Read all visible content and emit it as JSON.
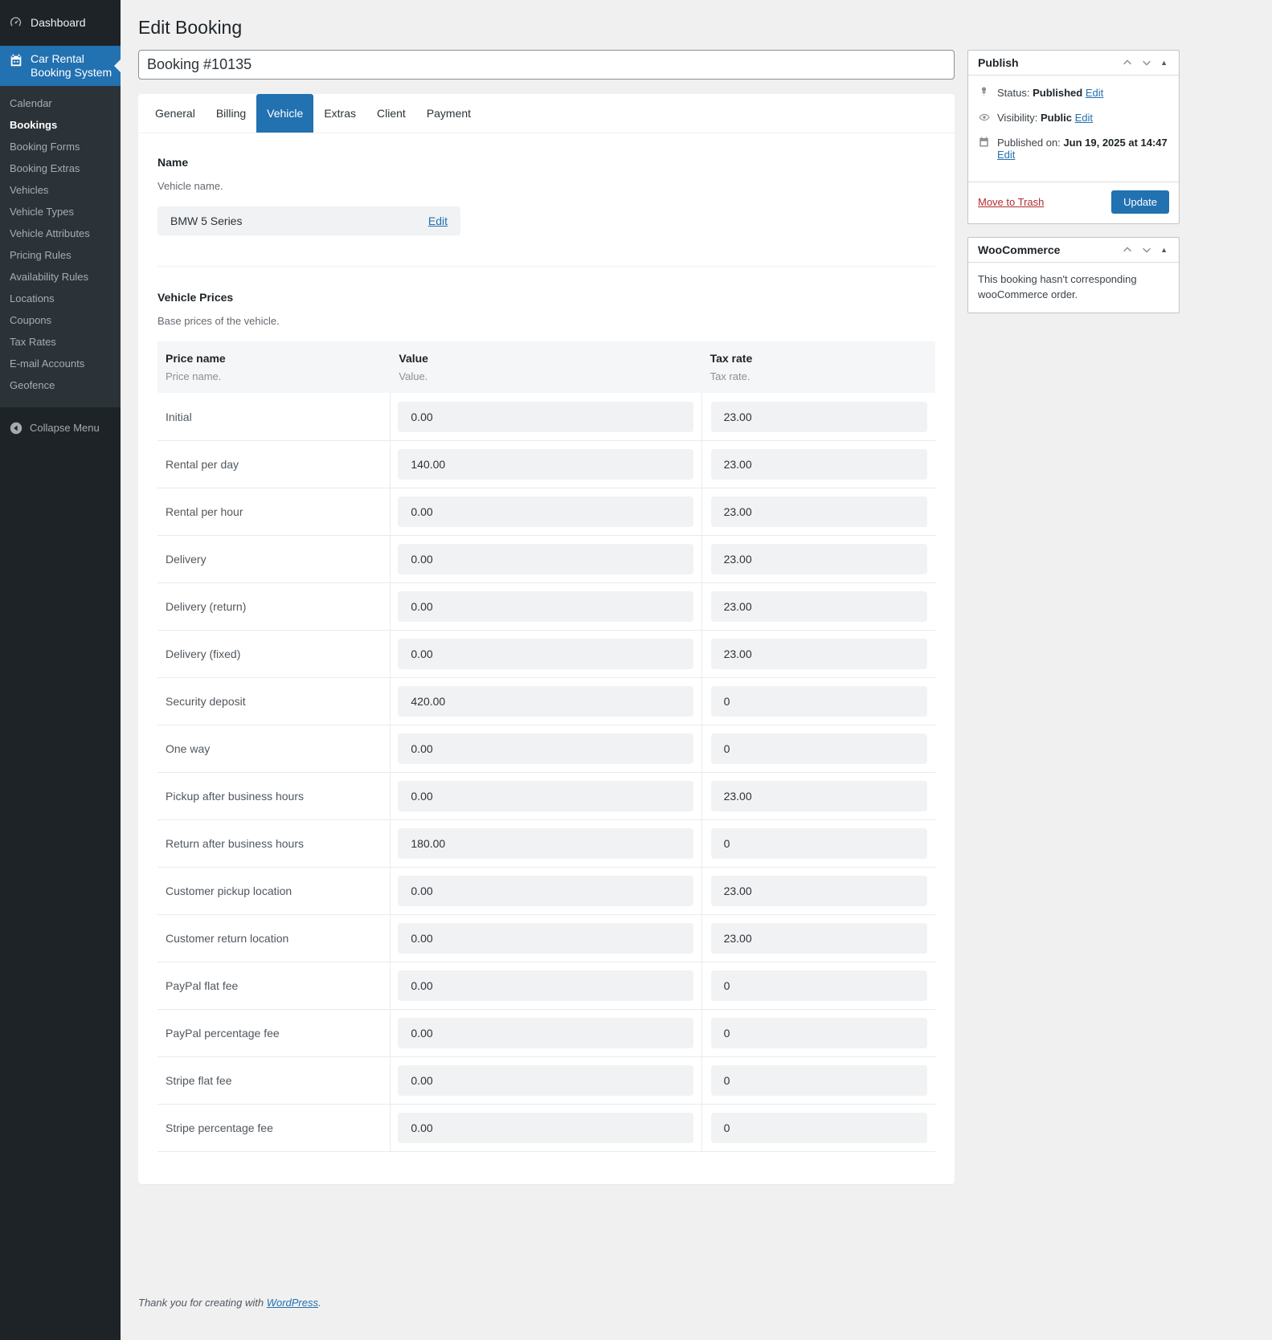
{
  "sidebar": {
    "dashboard_label": "Dashboard",
    "plugin_line1": "Car Rental",
    "plugin_line2": "Booking System",
    "items": [
      "Calendar",
      "Bookings",
      "Booking Forms",
      "Booking Extras",
      "Vehicles",
      "Vehicle Types",
      "Vehicle Attributes",
      "Pricing Rules",
      "Availability Rules",
      "Locations",
      "Coupons",
      "Tax Rates",
      "E-mail Accounts",
      "Geofence"
    ],
    "active_item": "Bookings",
    "collapse_label": "Collapse Menu"
  },
  "header": {
    "page_title": "Edit Booking",
    "booking_title": "Booking #10135"
  },
  "tabs": {
    "items": [
      "General",
      "Billing",
      "Vehicle",
      "Extras",
      "Client",
      "Payment"
    ],
    "active": "Vehicle"
  },
  "vehicle_tab": {
    "name_section": {
      "heading": "Name",
      "description": "Vehicle name.",
      "vehicle_name": "BMW 5 Series",
      "edit_label": "Edit"
    },
    "prices": {
      "heading": "Vehicle Prices",
      "description": "Base prices of the vehicle.",
      "columns": [
        {
          "label": "Price name",
          "sublabel": "Price name."
        },
        {
          "label": "Value",
          "sublabel": "Value."
        },
        {
          "label": "Tax rate",
          "sublabel": "Tax rate."
        }
      ],
      "rows": [
        {
          "name": "Initial",
          "value": "0.00",
          "tax": "23.00"
        },
        {
          "name": "Rental per day",
          "value": "140.00",
          "tax": "23.00"
        },
        {
          "name": "Rental per hour",
          "value": "0.00",
          "tax": "23.00"
        },
        {
          "name": "Delivery",
          "value": "0.00",
          "tax": "23.00"
        },
        {
          "name": "Delivery (return)",
          "value": "0.00",
          "tax": "23.00"
        },
        {
          "name": "Delivery (fixed)",
          "value": "0.00",
          "tax": "23.00"
        },
        {
          "name": "Security deposit",
          "value": "420.00",
          "tax": "0"
        },
        {
          "name": "One way",
          "value": "0.00",
          "tax": "0"
        },
        {
          "name": "Pickup after business hours",
          "value": "0.00",
          "tax": "23.00"
        },
        {
          "name": "Return after business hours",
          "value": "180.00",
          "tax": "0"
        },
        {
          "name": "Customer pickup location",
          "value": "0.00",
          "tax": "23.00"
        },
        {
          "name": "Customer return location",
          "value": "0.00",
          "tax": "23.00"
        },
        {
          "name": "PayPal flat fee",
          "value": "0.00",
          "tax": "0"
        },
        {
          "name": "PayPal percentage fee",
          "value": "0.00",
          "tax": "0"
        },
        {
          "name": "Stripe flat fee",
          "value": "0.00",
          "tax": "0"
        },
        {
          "name": "Stripe percentage fee",
          "value": "0.00",
          "tax": "0"
        }
      ]
    }
  },
  "publish_panel": {
    "title": "Publish",
    "status": {
      "label": "Status:",
      "value": "Published",
      "edit": "Edit"
    },
    "visibility": {
      "label": "Visibility:",
      "value": "Public",
      "edit": "Edit"
    },
    "published_on": {
      "label": "Published on:",
      "value": "Jun 19, 2025 at 14:47",
      "edit": "Edit"
    },
    "trash_label": "Move to Trash",
    "update_label": "Update"
  },
  "woocommerce_panel": {
    "title": "WooCommerce",
    "message": "This booking hasn't corresponding wooCommerce order."
  },
  "footer": {
    "text": "Thank you for creating with ",
    "link": "WordPress",
    "suffix": "."
  },
  "colors": {
    "accent": "#2271b1",
    "danger": "#b32d2e",
    "sidebar_bg": "#1d2327",
    "submenu_bg": "#2c3338"
  }
}
